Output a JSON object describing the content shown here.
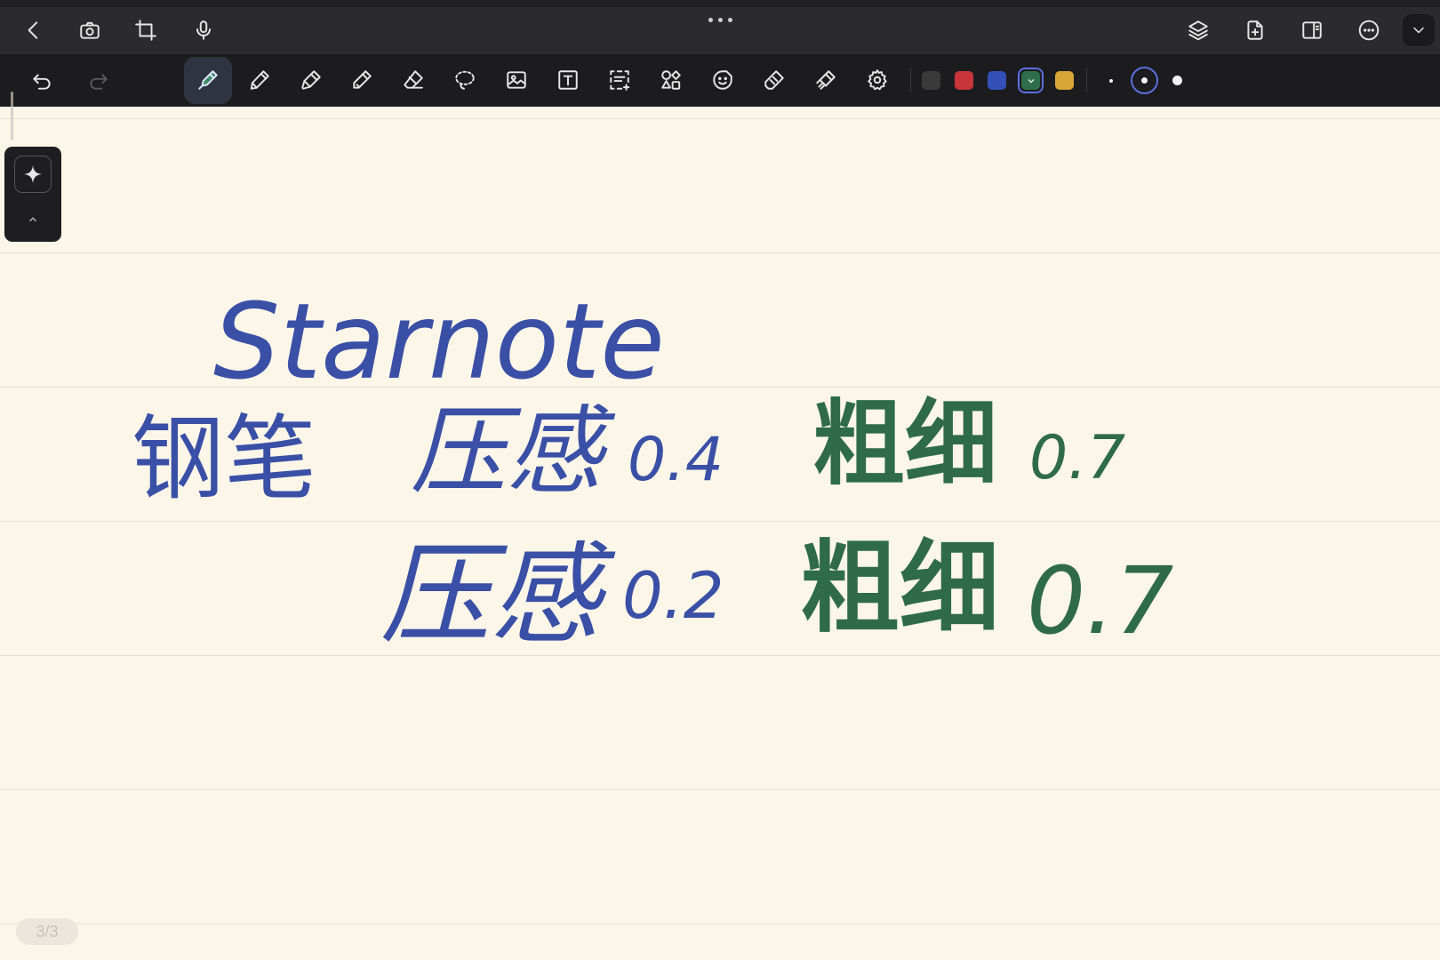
{
  "topbar": {
    "left_icons": [
      "back-icon",
      "camera-icon",
      "crop-icon",
      "microphone-icon"
    ],
    "right_icons": [
      "layers-icon",
      "add-page-icon",
      "split-view-icon",
      "more-options-icon",
      "chevron-down-icon"
    ]
  },
  "toolbar": {
    "tools": [
      "fountain-pen-icon",
      "pencil-icon",
      "marker-icon",
      "highlighter-icon",
      "eraser-icon",
      "lasso-icon",
      "image-icon",
      "text-box-icon",
      "text-select-icon",
      "shapes-icon",
      "sticker-icon",
      "laser-pointer-icon",
      "tape-icon",
      "settings-icon"
    ],
    "active_tool": "fountain-pen-icon",
    "colors": [
      "#3a3a3a",
      "#c9363a",
      "#3250b8",
      "#2f6e4c",
      "#d8a638"
    ],
    "selected_color": "#2f6e4c",
    "selected_size": "medium"
  },
  "canvas": {
    "background": "#fbf6e8",
    "handwriting": {
      "line1": "Starnote",
      "line2_left": "钢笔",
      "line2_mid": "压感",
      "line2_val": "0.4",
      "line2_right": "粗细",
      "line2_right_val": "0.7",
      "line3_mid": "压感",
      "line3_val": "0.2",
      "line3_right": "粗细",
      "line3_right_val": "0.7"
    },
    "ink_colors": {
      "blue": "#3a4fa6",
      "green": "#2f6b47"
    }
  },
  "page_indicator": "3/3"
}
